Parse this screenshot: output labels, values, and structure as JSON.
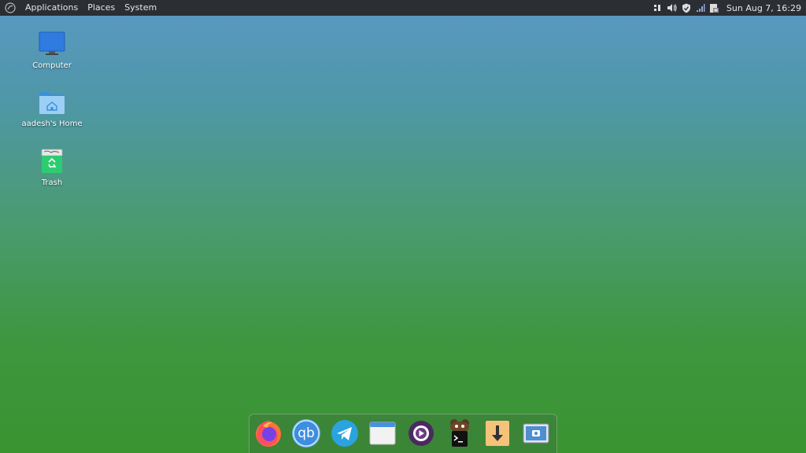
{
  "topbar": {
    "menu": [
      {
        "label": "Applications"
      },
      {
        "label": "Places"
      },
      {
        "label": "System"
      }
    ],
    "clock": "Sun Aug 7, 16:29",
    "tray_icons": [
      "accessibility-icon",
      "volume-icon",
      "shield-icon",
      "network-signal-icon",
      "updates-icon"
    ]
  },
  "desktop": {
    "icons": [
      {
        "label": "Computer",
        "icon": "computer-icon"
      },
      {
        "label": "aadesh's Home",
        "icon": "home-folder-icon"
      },
      {
        "label": "Trash",
        "icon": "trash-icon"
      }
    ]
  },
  "dock": {
    "items": [
      {
        "name": "firefox"
      },
      {
        "name": "qbittorrent",
        "text": "qb"
      },
      {
        "name": "telegram"
      },
      {
        "name": "window"
      },
      {
        "name": "media-player"
      },
      {
        "name": "terminal"
      },
      {
        "name": "downloader"
      },
      {
        "name": "screenshot"
      }
    ]
  },
  "colors": {
    "topbar": "#2b2e33",
    "computer_blue": "#2f7be0",
    "folder_blue": "#5aa8ea",
    "trash_green": "#2ecc71"
  }
}
